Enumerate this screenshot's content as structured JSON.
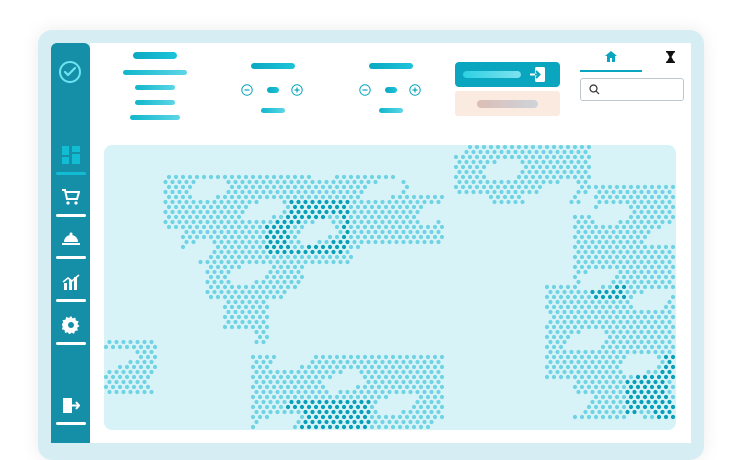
{
  "app": {
    "sidebar": {
      "logo_icon": "chat-bubble-check-icon",
      "items": [
        {
          "name": "dashboard",
          "icon": "grid-icon",
          "active": true
        },
        {
          "name": "orders",
          "icon": "shopping-cart-icon",
          "active": false
        },
        {
          "name": "menu",
          "icon": "cloche-icon",
          "active": false
        },
        {
          "name": "analytics",
          "icon": "bar-chart-icon",
          "active": false
        },
        {
          "name": "settings",
          "icon": "gear-icon",
          "active": false
        }
      ],
      "logout_icon": "logout-icon"
    },
    "header": {
      "tabs": [
        {
          "icon": "home-icon",
          "active": true
        },
        {
          "icon": "hourglass-icon",
          "active": false
        }
      ],
      "search": {
        "placeholder": "",
        "value": "",
        "icon": "search-icon"
      },
      "primary_button_icon": "sign-in-icon"
    },
    "map": {
      "region": "world-dot-map"
    },
    "colors": {
      "accent": "#0aa5bf",
      "sidebar": "#158fa8",
      "map_bg": "#d8f3f8",
      "dot_light": "#6fd3e3",
      "dot_dark": "#0a9fb8",
      "secondary_button": "#fbeae0"
    }
  }
}
